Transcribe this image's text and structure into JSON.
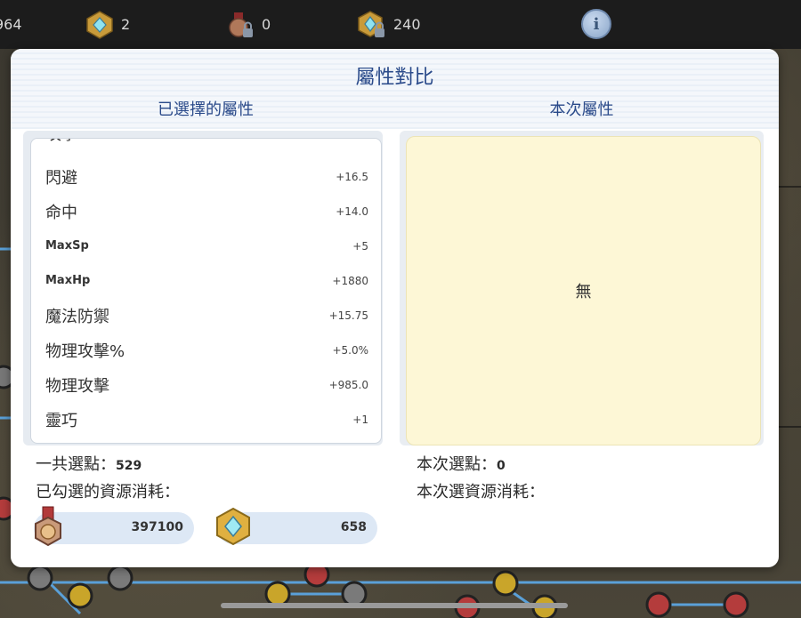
{
  "topbar": {
    "resources": [
      {
        "icon": "partial-counter",
        "value": "964"
      },
      {
        "icon": "gold-crystal-badge-icon",
        "value": "2"
      },
      {
        "icon": "locked-medal-icon",
        "value": "0"
      },
      {
        "icon": "locked-crystal-badge-icon",
        "value": "240"
      }
    ],
    "info_icon": "info-icon"
  },
  "modal": {
    "title": "屬性對比",
    "left_header": "已選擇的屬性",
    "right_header": "本次屬性",
    "attributes": [
      {
        "name": "閃避",
        "value": "+16.5"
      },
      {
        "name": "命中",
        "value": "+14.0"
      },
      {
        "name": "MaxSp",
        "value": "+5"
      },
      {
        "name": "MaxHp",
        "value": "+1880"
      },
      {
        "name": "魔法防禦",
        "value": "+15.75"
      },
      {
        "name": "物理攻擊%",
        "value": "+5.0%"
      },
      {
        "name": "物理攻擊",
        "value": "+985.0"
      },
      {
        "name": "靈巧",
        "value": "+1"
      }
    ],
    "right_empty_text": "無",
    "total_points_label": "一共選點：",
    "total_points_value": "529",
    "selected_cost_label": "已勾選的資源消耗：",
    "current_points_label": "本次選點：",
    "current_points_value": "0",
    "current_cost_label": "本次選資源消耗：",
    "costs": [
      {
        "icon": "medal-icon",
        "value": "397100"
      },
      {
        "icon": "crystal-badge-icon",
        "value": "658"
      }
    ]
  },
  "colors": {
    "title_blue": "#2a4a8a",
    "highlight_yellow": "#fdf7d6",
    "pill_blue": "#dde8f5"
  }
}
